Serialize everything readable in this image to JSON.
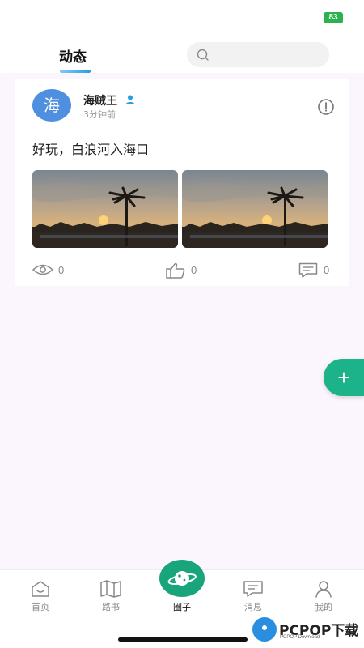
{
  "status_bar": {
    "battery": "83"
  },
  "header": {
    "active_tab": "动态",
    "search_placeholder": ""
  },
  "post": {
    "avatar_char": "海",
    "username": "海贼王",
    "time": "3分钟前",
    "content": "好玩，白浪河入海口",
    "images": [
      "sunset-palm-1",
      "sunset-palm-2"
    ],
    "views": "0",
    "likes": "0",
    "comments": "0"
  },
  "fab": {
    "label": "+"
  },
  "tabbar": {
    "items": [
      {
        "label": "首页",
        "icon": "home-icon"
      },
      {
        "label": "路书",
        "icon": "map-book-icon"
      },
      {
        "label": "圈子",
        "icon": "planet-icon"
      },
      {
        "label": "消息",
        "icon": "message-icon"
      },
      {
        "label": "我的",
        "icon": "user-icon"
      }
    ]
  },
  "watermark": {
    "text": "PCPOP下载",
    "sub": "PCPOP Download"
  },
  "colors": {
    "accent": "#19a57c",
    "avatar": "#4f8fe0",
    "tab_underline": "#2a9de0"
  }
}
